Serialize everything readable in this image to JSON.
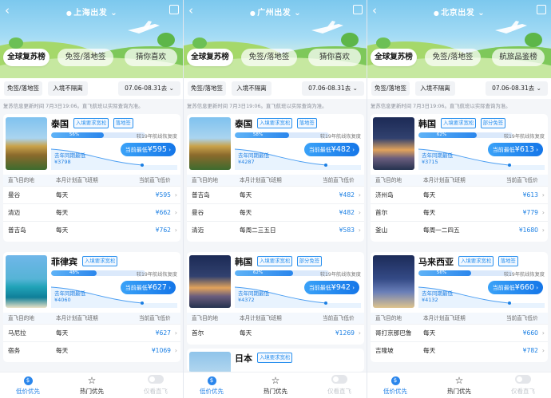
{
  "panels": [
    {
      "city": "上海出发",
      "tabs": [
        "全球复苏榜",
        "免签/落地签",
        "猜你喜欢"
      ],
      "filters": [
        "免签/落地签",
        "入境不隔离",
        "07.06-08.31去"
      ],
      "notice": "复苏信息更新时间 7月3日19:06。直飞航班以实际查询为准。",
      "cards": [
        {
          "country": "泰国",
          "tags": [
            "入境要求宽松",
            "落地签"
          ],
          "progress_pct": 56,
          "progress_label": "56%",
          "recovery": "较19年航线恢复度",
          "last_year_label": "去年同期最低",
          "last_year_price": "¥3798",
          "lowest_label": "当前最低",
          "lowest_price": "¥595",
          "headers": [
            "直飞目的地",
            "本月计划直飞班期",
            "当前直飞低价"
          ],
          "rows": [
            {
              "city": "曼谷",
              "schedule": "每天",
              "price": "¥595"
            },
            {
              "city": "清迈",
              "schedule": "每天",
              "price": "¥662"
            },
            {
              "city": "普吉岛",
              "schedule": "每天",
              "price": "¥762"
            }
          ]
        },
        {
          "country": "菲律宾",
          "tags": [
            "入境要求宽松"
          ],
          "progress_pct": 48,
          "progress_label": "48%",
          "recovery": "较19年航线恢复度",
          "last_year_label": "去年同期最低",
          "last_year_price": "¥4060",
          "lowest_label": "当前最低",
          "lowest_price": "¥627",
          "headers": [
            "直飞目的地",
            "本月计划直飞班期",
            "当前直飞低价"
          ],
          "rows": [
            {
              "city": "马尼拉",
              "schedule": "每天",
              "price": "¥627"
            },
            {
              "city": "宿务",
              "schedule": "每天",
              "price": "¥1069"
            }
          ]
        }
      ],
      "nav": [
        "低价优先",
        "热门优先",
        "仅看直飞"
      ]
    },
    {
      "city": "广州出发",
      "tabs": [
        "全球复苏榜",
        "免签/落地签",
        "猜你喜欢"
      ],
      "filters": [
        "免签/落地签",
        "入境不隔离",
        "07.06-08.31去"
      ],
      "notice": "复苏信息更新时间 7月3日19:06。直飞航班以实际查询为准。",
      "cards": [
        {
          "country": "泰国",
          "tags": [
            "入境要求宽松",
            "落地签"
          ],
          "progress_pct": 58,
          "progress_label": "58%",
          "recovery": "较19年航线恢复度",
          "last_year_label": "去年同期最低",
          "last_year_price": "¥4287",
          "lowest_label": "当前最低",
          "lowest_price": "¥482",
          "headers": [
            "直飞目的地",
            "本月计划直飞班期",
            "当前直飞低价"
          ],
          "rows": [
            {
              "city": "普吉岛",
              "schedule": "每天",
              "price": "¥482"
            },
            {
              "city": "曼谷",
              "schedule": "每天",
              "price": "¥482"
            },
            {
              "city": "清迈",
              "schedule": "每周二三五日",
              "price": "¥583"
            }
          ]
        },
        {
          "country": "韩国",
          "tags": [
            "入境要求宽松",
            "部分免签"
          ],
          "progress_pct": 62,
          "progress_label": "62%",
          "recovery": "较19年航线恢复度",
          "last_year_label": "去年同期最低",
          "last_year_price": "¥4372",
          "lowest_label": "当前最低",
          "lowest_price": "¥942",
          "headers": [
            "直飞目的地",
            "本月计划直飞班期",
            "当前直飞低价"
          ],
          "rows": [
            {
              "city": "首尔",
              "schedule": "每天",
              "price": "¥1269"
            }
          ]
        },
        {
          "country": "日本",
          "tags": [
            "入境要求宽松"
          ],
          "progress_pct": 0,
          "progress_label": "",
          "recovery": "",
          "last_year_label": "",
          "last_year_price": "",
          "lowest_label": "",
          "lowest_price": "",
          "headers": [],
          "rows": []
        }
      ],
      "nav": [
        "低价优先",
        "热门优先",
        "仅看直飞"
      ]
    },
    {
      "city": "北京出发",
      "tabs": [
        "全球复苏榜",
        "免签/落地签",
        "航旅品鉴榜"
      ],
      "filters": [
        "免签/落地签",
        "入境不隔离",
        "07.06-08.31去"
      ],
      "notice": "复苏信息更新时间 7月3日19:06。直飞航班以实际查询为准。",
      "cards": [
        {
          "country": "韩国",
          "tags": [
            "入境要求宽松",
            "部分免签"
          ],
          "progress_pct": 62,
          "progress_label": "62%",
          "recovery": "较19年航线恢复度",
          "last_year_label": "去年同期最低",
          "last_year_price": "¥3715",
          "lowest_label": "当前最低",
          "lowest_price": "¥613",
          "headers": [
            "直飞目的地",
            "本月计划直飞班期",
            "当前直飞低价"
          ],
          "rows": [
            {
              "city": "济州岛",
              "schedule": "每天",
              "price": "¥613"
            },
            {
              "city": "首尔",
              "schedule": "每天",
              "price": "¥779"
            },
            {
              "city": "釜山",
              "schedule": "每周一二四五",
              "price": "¥1680"
            }
          ]
        },
        {
          "country": "马来西亚",
          "tags": [
            "入境要求宽松",
            "落地签"
          ],
          "progress_pct": 56,
          "progress_label": "56%",
          "recovery": "较19年航线恢复度",
          "last_year_label": "去年同期最低",
          "last_year_price": "¥4132",
          "lowest_label": "当前最低",
          "lowest_price": "¥660",
          "headers": [
            "直飞目的地",
            "本月计划直飞班期",
            "当前直飞低价"
          ],
          "rows": [
            {
              "city": "哥打京那巴鲁",
              "schedule": "每天",
              "price": "¥660"
            },
            {
              "city": "吉隆坡",
              "schedule": "每天",
              "price": "¥782"
            }
          ]
        }
      ],
      "nav": [
        "低价优先",
        "热门优先",
        "仅看直飞"
      ]
    }
  ],
  "colors": {
    "accent": "#1e7fe6",
    "tag_border": "#2a90ee",
    "sky": "#7cc8ee"
  },
  "icons": {
    "back": "chevron-left-icon",
    "location": "location-pin-icon",
    "share": "share-icon",
    "dropdown": "chevron-down-icon",
    "hot": "star-outline-icon",
    "direct": "toggle-icon"
  }
}
